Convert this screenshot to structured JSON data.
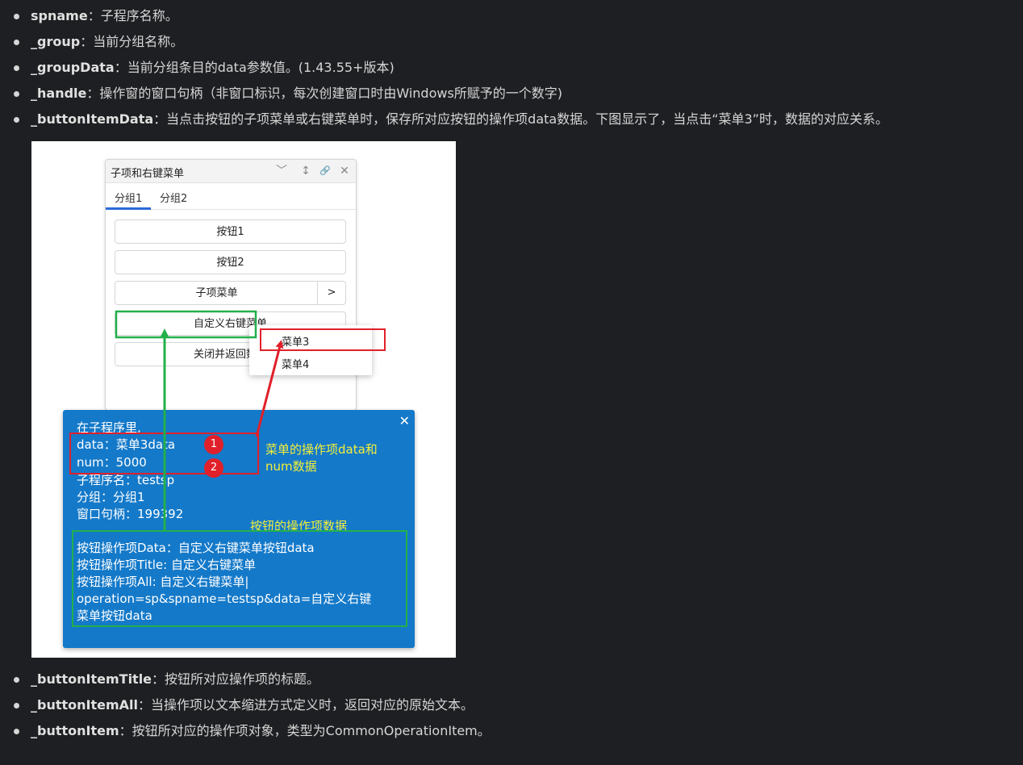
{
  "top_items": [
    {
      "term": "spname",
      "desc": "：子程序名称。"
    },
    {
      "term": "_group",
      "desc": "：当前分组名称。"
    },
    {
      "term": "_groupData",
      "desc": "：当前分组条目的data参数值。(1.43.55+版本)"
    },
    {
      "term": "_handle",
      "desc": "：操作窗的窗口句柄（非窗口标识，每次创建窗口时由Windows所赋予的一个数字)"
    },
    {
      "term": "_buttonItemData",
      "desc": "：当点击按钮的子项菜单或右键菜单时，保存所对应按钮的操作项data数据。下图显示了，当点击“菜单3”时，数据的对应关系。"
    }
  ],
  "bottom_items": [
    {
      "term": "_buttonItemTitle",
      "desc": "：按钮所对应操作项的标题。"
    },
    {
      "term": "_buttonItemAll",
      "desc": "：当操作项以文本缩进方式定义时，返回对应的原始文本。"
    },
    {
      "term": "_buttonItem",
      "desc": "：按钮所对应的操作项对象，类型为CommonOperationItem。"
    }
  ],
  "figure": {
    "window": {
      "title": "子项和右键菜单",
      "controls": [
        "﹀",
        "↕",
        "🔗",
        "✕"
      ],
      "tabs": [
        "分组1",
        "分组2"
      ],
      "buttons": [
        "按钮1",
        "按钮2",
        "子项菜单",
        "自定义右键菜单",
        "关闭并返回数据"
      ],
      "submenu_arrow": ">"
    },
    "context_menu": [
      "菜单3",
      "菜单4"
    ],
    "panel": {
      "close": "✕",
      "lines": [
        "在子程序里,",
        "data：菜单3data",
        "num：5000",
        "子程序名：testsp",
        "分组：分组1",
        "窗口句柄：199392"
      ],
      "button_lines": [
        "按钮操作项Data：自定义右键菜单按钮data",
        "按钮操作项Title: 自定义右键菜单",
        "按钮操作项All: 自定义右键菜单|",
        "operation=sp&spname=testsp&data=自定义右键",
        "菜单按钮data"
      ]
    },
    "annotations": {
      "menu_note_1": "菜单的操作项data和",
      "menu_note_2": "num数据",
      "button_note": "按钮的操作项数据",
      "circle_1": "1",
      "circle_2": "2"
    },
    "colors": {
      "red": "#e0202a",
      "green": "#22b04a",
      "blue_panel": "#1479c9",
      "yellow": "#f3ef3a"
    }
  }
}
